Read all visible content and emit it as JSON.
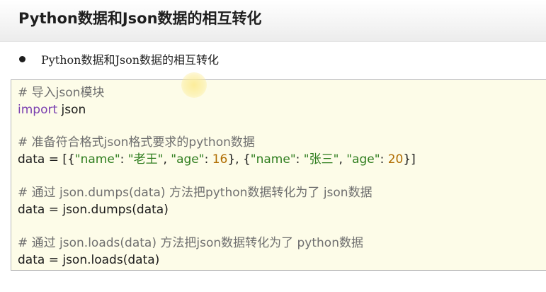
{
  "header": {
    "title": "Python数据和Json数据的相互转化"
  },
  "bullet": {
    "text": "Python数据和Json数据的相互转化"
  },
  "code": {
    "comment_import": "# 导入json模块",
    "import_kw": "import",
    "import_rest": " json",
    "comment_prepare": "# 准备符合格式json格式要求的python数据",
    "data_line": {
      "prefix": "data = [{",
      "k1": "\"name\"",
      "sep1": ": ",
      "v1": "\"老王\"",
      "sep2": ", ",
      "k2": "\"age\"",
      "sep3": ": ",
      "n1": "16",
      "mid": "}, {",
      "k3": "\"name\"",
      "sep4": ": ",
      "v2": "\"张三\"",
      "sep5": ", ",
      "k4": "\"age\"",
      "sep6": ": ",
      "n2": "20",
      "suffix": "}]"
    },
    "comment_dumps": "# 通过 json.dumps(data) 方法把python数据转化为了 json数据",
    "dumps_line": "data = json.dumps(data)",
    "comment_loads": "# 通过 json.loads(data) 方法把json数据转化为了 python数据",
    "loads_line": "data = json.loads(data)"
  },
  "colors": {
    "code_background": "#fdfce8",
    "keyword": "#7a3fb0",
    "string": "#2e7d1e",
    "number": "#b06c00",
    "comment": "#6f6f6f"
  }
}
